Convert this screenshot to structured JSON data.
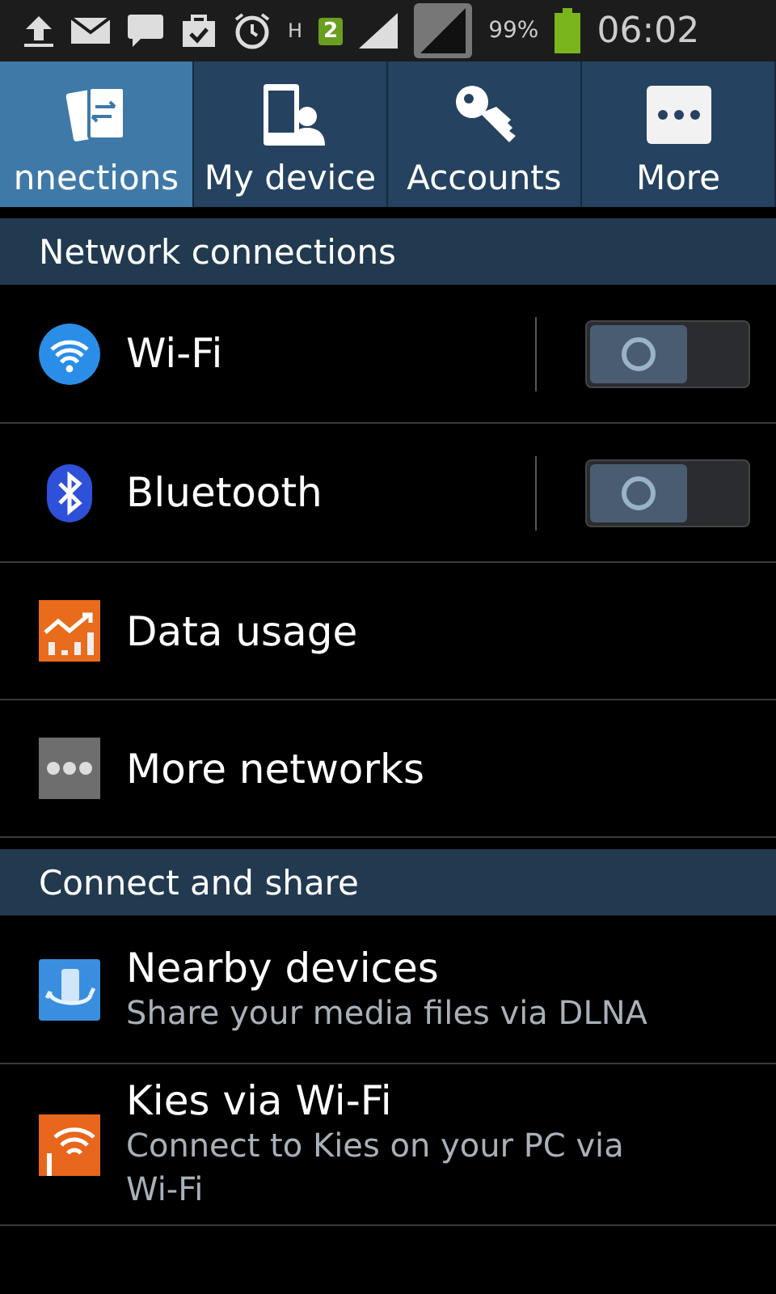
{
  "status_bar": {
    "network_type": "H",
    "sim_badge": "2",
    "battery": "99%",
    "time": "06:02"
  },
  "tabs": [
    {
      "label": "nnections",
      "selected": true
    },
    {
      "label": "My device",
      "selected": false
    },
    {
      "label": "Accounts",
      "selected": false
    },
    {
      "label": "More",
      "selected": false
    }
  ],
  "sections": [
    {
      "title": "Network connections",
      "items": [
        {
          "kind": "toggle",
          "label": "Wi-Fi",
          "on": false
        },
        {
          "kind": "toggle",
          "label": "Bluetooth",
          "on": false
        },
        {
          "kind": "plain",
          "label": "Data usage"
        },
        {
          "kind": "plain",
          "label": "More networks"
        }
      ]
    },
    {
      "title": "Connect and share",
      "items": [
        {
          "kind": "subtitle",
          "label": "Nearby devices",
          "subtitle": "Share your media files via DLNA"
        },
        {
          "kind": "subtitle",
          "label": "Kies via Wi-Fi",
          "subtitle": "Connect to Kies on your PC via Wi-Fi"
        }
      ]
    }
  ]
}
